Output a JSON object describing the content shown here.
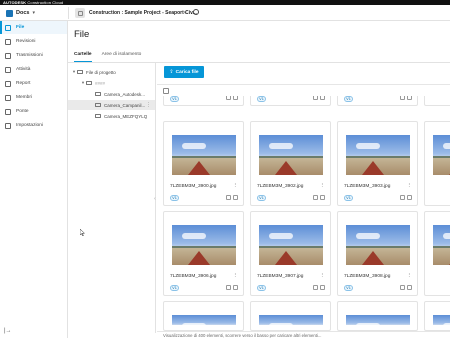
{
  "brand": {
    "name": "AUTODESK",
    "product": "Construction Cloud"
  },
  "header": {
    "app_name": "Docs",
    "project_name": "Construction : Sample Project - Seaport Civ..."
  },
  "sidebar": {
    "items": [
      {
        "label": "File",
        "icon": "folder-icon",
        "active": true
      },
      {
        "label": "Revisioni",
        "icon": "revisions-icon"
      },
      {
        "label": "Trasmissioni",
        "icon": "transmittals-icon"
      },
      {
        "label": "Attività",
        "icon": "activity-icon"
      },
      {
        "label": "Report",
        "icon": "report-icon"
      },
      {
        "label": "Membri",
        "icon": "members-icon"
      },
      {
        "label": "Ponte",
        "icon": "bridge-icon"
      },
      {
        "label": "Impostazioni",
        "icon": "gear-icon"
      }
    ]
  },
  "main": {
    "title": "File",
    "tabs": [
      {
        "label": "Cartelle",
        "active": true
      },
      {
        "label": "Aree di isolamento"
      }
    ]
  },
  "tree": {
    "root": "File di progetto",
    "group": "####",
    "children": [
      {
        "label": "Camera_Autodesk..."
      },
      {
        "label": "Camera_Campanil...",
        "selected": true
      },
      {
        "label": "Camera_MEZFQYLQ"
      }
    ]
  },
  "toolbar": {
    "upload_label": "Carica file"
  },
  "files": [
    {
      "name": "7LZEBM3M_3900.jpg",
      "version": "V1"
    },
    {
      "name": "7LZEBM3M_3902.jpg",
      "version": "V1"
    },
    {
      "name": "7LZEBM3M_3903.jpg",
      "version": "V1"
    },
    {
      "name": "7LZEBM3M_3906.jpg",
      "version": "V1"
    },
    {
      "name": "7LZEBM3M_3907.jpg",
      "version": "V1"
    },
    {
      "name": "7LZEBM3M_3908.jpg",
      "version": "V1"
    }
  ],
  "top_row_versions": [
    "V1",
    "V1",
    "V1"
  ],
  "status": {
    "text": "Visualizzazione di 400 elementi, scorrere verso il basso per caricare altri elementi..."
  },
  "colors": {
    "accent": "#0696d7",
    "brand_bar": "#111111"
  }
}
